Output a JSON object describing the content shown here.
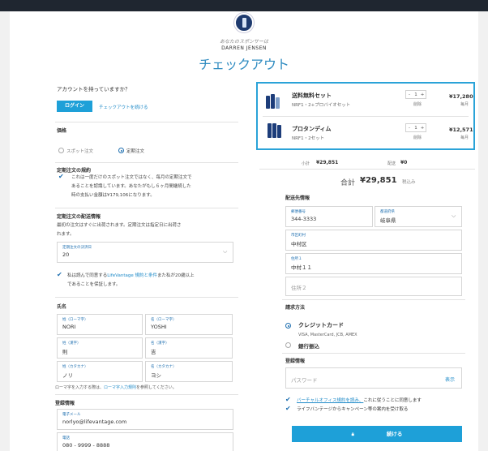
{
  "header": {
    "sponsor_label": "あなたのスポンサーは",
    "sponsor_name": "DARREN JENSEN",
    "title": "チェックアウト"
  },
  "account": {
    "question": "アカウントを持っていますか？",
    "login_button": "ログイン",
    "continue_link": "チェックアウトを続ける"
  },
  "price": {
    "label": "価格",
    "spot": "スポット注文",
    "subscription": "定期注文"
  },
  "contract": {
    "label": "定期注文の規約",
    "text1": "これは一度だけのスポット注文ではなく、毎月の定期注文で",
    "text2": "あることを認識しています。あなたがもし６ヶ月間継続した",
    "text3": "時の支払い金額は¥179,106になります。"
  },
  "delivery_date": {
    "label": "定期注文の配送情報",
    "text1": "最初の注文はすぐに出荷されます。定期注文は指定日に出荷さ",
    "text2": "れます。",
    "field_label": "定期注文の決済日",
    "field_value": "20",
    "agree_prefix": "私は読んで同意する",
    "agree_link": "LifeVantage 規約と条件",
    "agree_suffix": "また私が20歳以上",
    "agree_line2": "であることを保証します。"
  },
  "name": {
    "label": "氏名",
    "last_roman_label": "姓（ローマ字）",
    "last_roman": "NORI",
    "first_roman_label": "名（ローマ字）",
    "first_roman": "YOSHI",
    "last_kanji_label": "姓（漢字）",
    "last_kanji": "則",
    "first_kanji_label": "名（漢字）",
    "first_kanji": "吉",
    "last_kana_label": "姓（カタカナ）",
    "last_kana": "ノリ",
    "first_kana_label": "名（カタカナ）",
    "first_kana": "ヨシ",
    "note_prefix": "ローマ字を入力する際は、",
    "note_link": "ローマ字入力規則",
    "note_suffix": "を参照してください。"
  },
  "registration": {
    "label": "登録情報",
    "email_label": "電子メール",
    "email": "norlyo@lifevantage.com",
    "phone_label": "電話",
    "phone": "080 - 9999 - 8888"
  },
  "cart": {
    "items": [
      {
        "name": "送料無料セット",
        "sub": "NRF1・2+プロバイオセット",
        "qty": "1",
        "remove": "削除",
        "price": "¥17,280",
        "freq": "毎月"
      },
      {
        "name": "プロタンディム",
        "sub": "NRF1・2セット",
        "qty": "1",
        "remove": "削除",
        "price": "¥12,571",
        "freq": "毎月"
      }
    ],
    "subtotal_label": "小計",
    "subtotal": "¥29,851",
    "shipping_label": "配送",
    "shipping": "¥0",
    "total_label": "合計",
    "total": "¥29,851",
    "tax_label": "税込み"
  },
  "shipping": {
    "label": "配送先情報",
    "zip_label": "郵便番号",
    "zip": "344-3333",
    "pref_label": "都道府県",
    "pref": "岐阜県",
    "city_label": "市区町村",
    "city": "中村区",
    "addr1_label": "住所１",
    "addr1": "中村１１",
    "addr2_placeholder": "住所２"
  },
  "payment": {
    "label": "請求方法",
    "credit": "クレジットカード",
    "credit_sub": "VISA, MasterCard, JCB, AMEX",
    "bank": "銀行振込"
  },
  "login_info": {
    "label": "登録情報",
    "password_placeholder": "パスワード",
    "show": "表示",
    "agree1_link": "バーチャルオフィス規約を読み、",
    "agree1_rest": "これに従うことに同意します",
    "agree2": "ライフバンテージからキャンペーン等の案内を受け取る",
    "submit": "続ける"
  },
  "colors": {
    "accent": "#1ea0d8",
    "title": "#2e8bc0",
    "topbar": "#1f2630"
  }
}
